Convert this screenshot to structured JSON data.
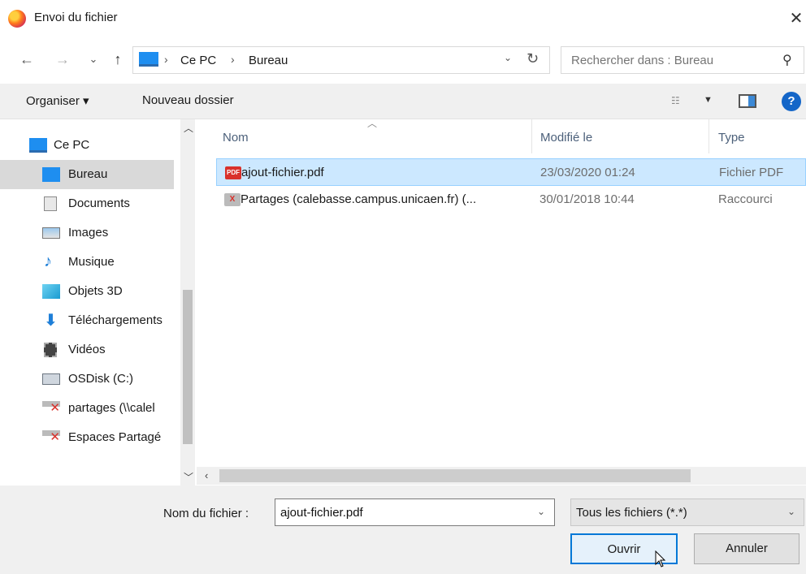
{
  "window": {
    "title": "Envoi du fichier",
    "close_symbol": "✕"
  },
  "nav": {
    "back_symbol": "←",
    "forward_symbol": "→",
    "recent_symbol": "⌄",
    "up_symbol": "↑",
    "breadcrumb": [
      "Ce PC",
      "Bureau"
    ],
    "separator": "›",
    "refresh_symbol": "↻"
  },
  "search": {
    "placeholder": "Rechercher dans : Bureau",
    "icon": "search-icon"
  },
  "toolbar": {
    "organise_label": "Organiser ▾",
    "new_folder_label": "Nouveau dossier",
    "help_label": "?"
  },
  "sidebar": {
    "items": [
      {
        "label": "Ce PC",
        "icon": "pc-icon"
      },
      {
        "label": "Bureau",
        "icon": "desktop-icon"
      },
      {
        "label": "Documents",
        "icon": "documents-icon"
      },
      {
        "label": "Images",
        "icon": "images-icon"
      },
      {
        "label": "Musique",
        "icon": "music-icon"
      },
      {
        "label": "Objets 3D",
        "icon": "3d-objects-icon"
      },
      {
        "label": "Téléchargements",
        "icon": "downloads-icon"
      },
      {
        "label": "Vidéos",
        "icon": "videos-icon"
      },
      {
        "label": "OSDisk (C:)",
        "icon": "disk-icon"
      },
      {
        "label": "partages (\\\\calel",
        "icon": "network-drive-icon"
      },
      {
        "label": "Espaces Partagé",
        "icon": "network-drive-icon"
      }
    ],
    "selected": "Bureau"
  },
  "columns": {
    "name": "Nom",
    "modified": "Modifié le",
    "type": "Type"
  },
  "files": [
    {
      "name": "ajout-fichier.pdf",
      "modified": "23/03/2020 01:24",
      "type": "Fichier PDF",
      "icon": "pdf-icon",
      "icon_text": "PDF"
    },
    {
      "name": "Partages (calebasse.campus.unicaen.fr) (...",
      "modified": "30/01/2018 10:44",
      "type": "Raccourci",
      "icon": "network-shortcut-icon",
      "icon_text": "X"
    }
  ],
  "bottom": {
    "filename_label": "Nom du fichier :",
    "filename_value": "ajout-fichier.pdf",
    "filter_label": "Tous les fichiers (*.*)",
    "open_label": "Ouvrir",
    "cancel_label": "Annuler"
  },
  "colors": {
    "selection": "#cce8ff",
    "accent": "#0078d7",
    "pdf_red": "#d9312b"
  }
}
